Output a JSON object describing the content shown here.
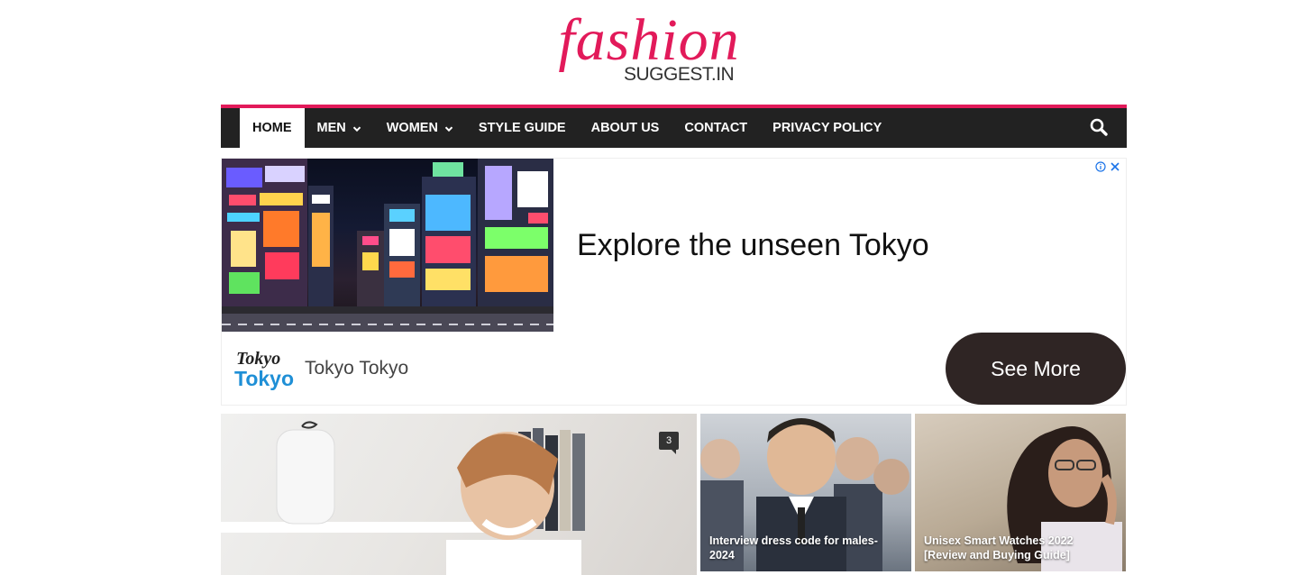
{
  "logo": {
    "script": "fashion",
    "sub": "SUGGEST.IN"
  },
  "nav": {
    "items": [
      {
        "label": "HOME",
        "active": true,
        "dropdown": false
      },
      {
        "label": "MEN",
        "active": false,
        "dropdown": true
      },
      {
        "label": "WOMEN",
        "active": false,
        "dropdown": true
      },
      {
        "label": "STYLE GUIDE",
        "active": false,
        "dropdown": false
      },
      {
        "label": "ABOUT US",
        "active": false,
        "dropdown": false
      },
      {
        "label": "CONTACT",
        "active": false,
        "dropdown": false
      },
      {
        "label": "PRIVACY POLICY",
        "active": false,
        "dropdown": false
      }
    ],
    "search_icon": "search-icon"
  },
  "ad": {
    "headline": "Explore the unseen Tokyo",
    "brand_logo_line1": "Tokyo",
    "brand_logo_line2": "Tokyo",
    "brand_name": "Tokyo Tokyo",
    "cta": "See More",
    "icons": [
      "info-icon",
      "close-icon"
    ]
  },
  "articles": [
    {
      "title": "",
      "comments": "3"
    },
    {
      "title": "Interview dress code for males- 2024"
    },
    {
      "title": "Unisex Smart Watches 2022 [Review and Buying Guide]"
    }
  ],
  "colors": {
    "accent": "#e21a5a",
    "nav_bg": "#222222",
    "cta_bg": "#2f2524",
    "brand_blue": "#1f8fd6"
  }
}
